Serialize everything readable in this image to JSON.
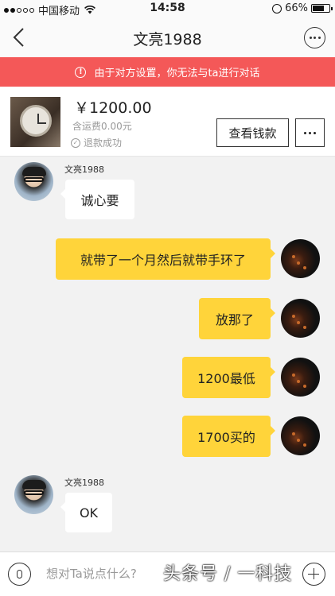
{
  "status_bar": {
    "carrier": "中国移动",
    "time": "14:58",
    "battery": "66%",
    "signal_dots_filled": 2,
    "signal_dots_total": 5
  },
  "nav": {
    "title": "文亮1988",
    "icons": [
      "chevron-left-icon",
      "more-circle-icon"
    ]
  },
  "banner": {
    "text": "由于对方设置，你无法与ta进行对话",
    "color": "#f45858"
  },
  "product": {
    "price": "￥1200.00",
    "shipping": "含运费0.00元",
    "status": "退款成功",
    "view_button": "查看钱款"
  },
  "messages": [
    {
      "side": "left",
      "sender": "文亮1988",
      "text": "诚心要"
    },
    {
      "side": "right",
      "text": "就带了一个月然后就带手环了"
    },
    {
      "side": "right",
      "text": "放那了"
    },
    {
      "side": "right",
      "text": "1200最低"
    },
    {
      "side": "right",
      "text": "1700买的"
    },
    {
      "side": "left",
      "sender": "文亮1988",
      "text": "OK"
    }
  ],
  "input": {
    "placeholder": "想对Ta说点什么?"
  },
  "watermark": "头条号 / 一科技",
  "colors": {
    "bubble_self": "#ffd43a",
    "bubble_other": "#ffffff",
    "background": "#f2f2f2"
  }
}
